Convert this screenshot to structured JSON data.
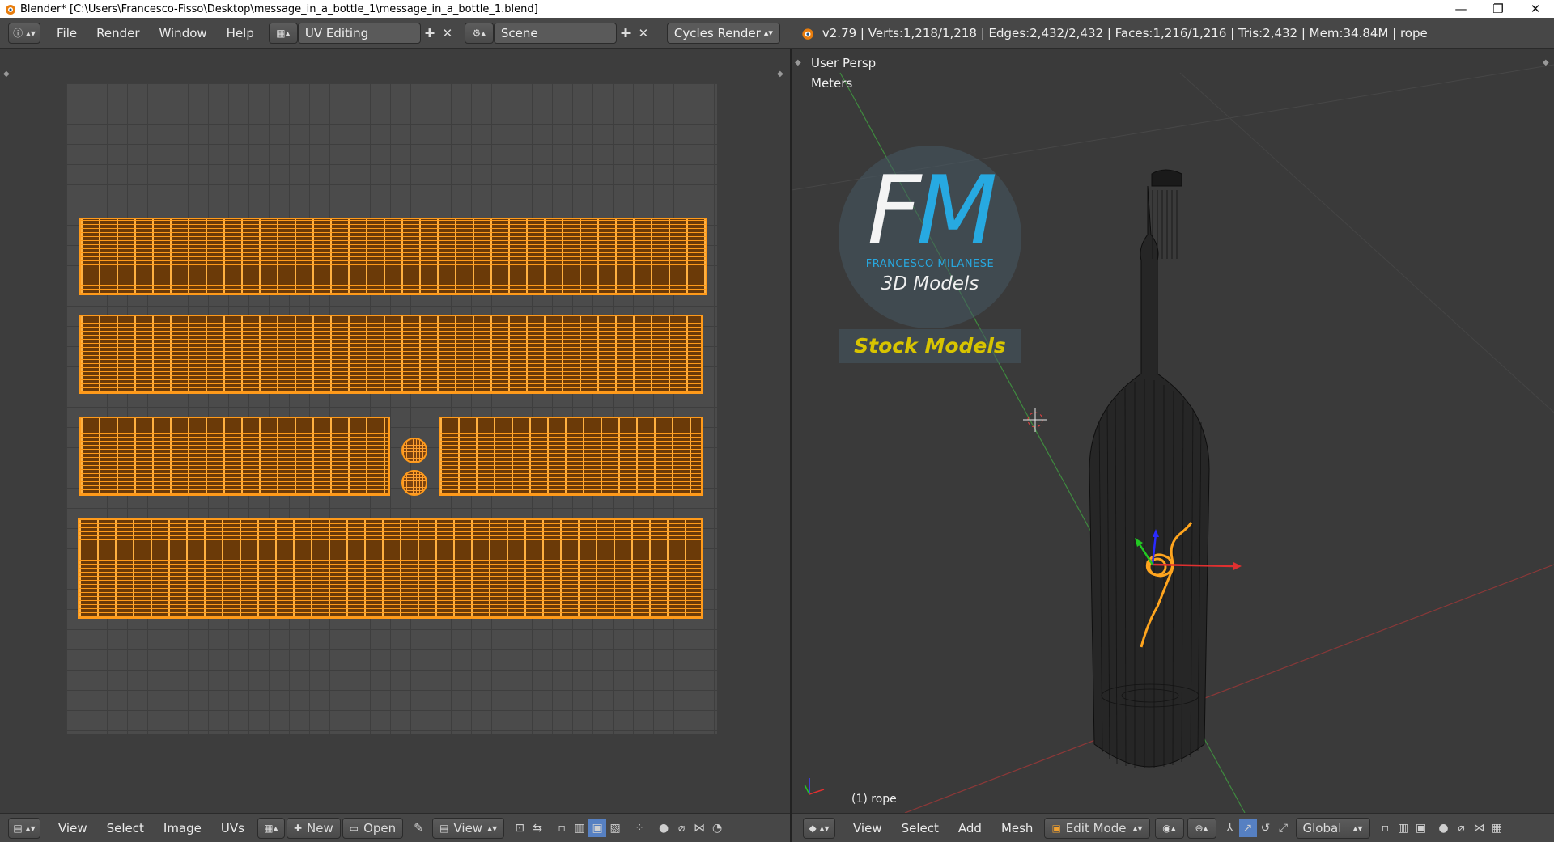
{
  "window": {
    "title": "Blender* [C:\\Users\\Francesco-Fisso\\Desktop\\message_in_a_bottle_1\\message_in_a_bottle_1.blend]",
    "minimize": "—",
    "maximize": "❐",
    "close": "✕"
  },
  "infobar": {
    "menus": [
      "File",
      "Render",
      "Window",
      "Help"
    ],
    "screen_layout": "UV Editing",
    "scene": "Scene",
    "render_engine": "Cycles Render",
    "stats": "v2.79 | Verts:1,218/1,218 | Edges:2,432/2,432 | Faces:1,216/1,216 | Tris:2,432 | Mem:34.84M | rope"
  },
  "uv_editor": {
    "header": {
      "menus": [
        "View",
        "Select",
        "Image",
        "UVs"
      ],
      "new_label": "New",
      "open_label": "Open",
      "view_label": "View"
    }
  },
  "viewport": {
    "view_label": "User Persp",
    "units_label": "Meters",
    "object_label": "(1) rope",
    "watermark": {
      "initials_f": "F",
      "initials_m": "M",
      "name": "FRANCESCO MILANESE",
      "tagline": "3D Models",
      "banner": "Stock Models"
    },
    "header": {
      "menus": [
        "View",
        "Select",
        "Add",
        "Mesh"
      ],
      "mode": "Edit Mode",
      "orientation": "Global"
    }
  },
  "colors": {
    "uv_selected": "#ff9a1a",
    "header_bg": "#474747",
    "viewport_bg": "#3a3a3a",
    "accent_blue": "#27a9e1",
    "banner_yellow": "#d8c400"
  }
}
